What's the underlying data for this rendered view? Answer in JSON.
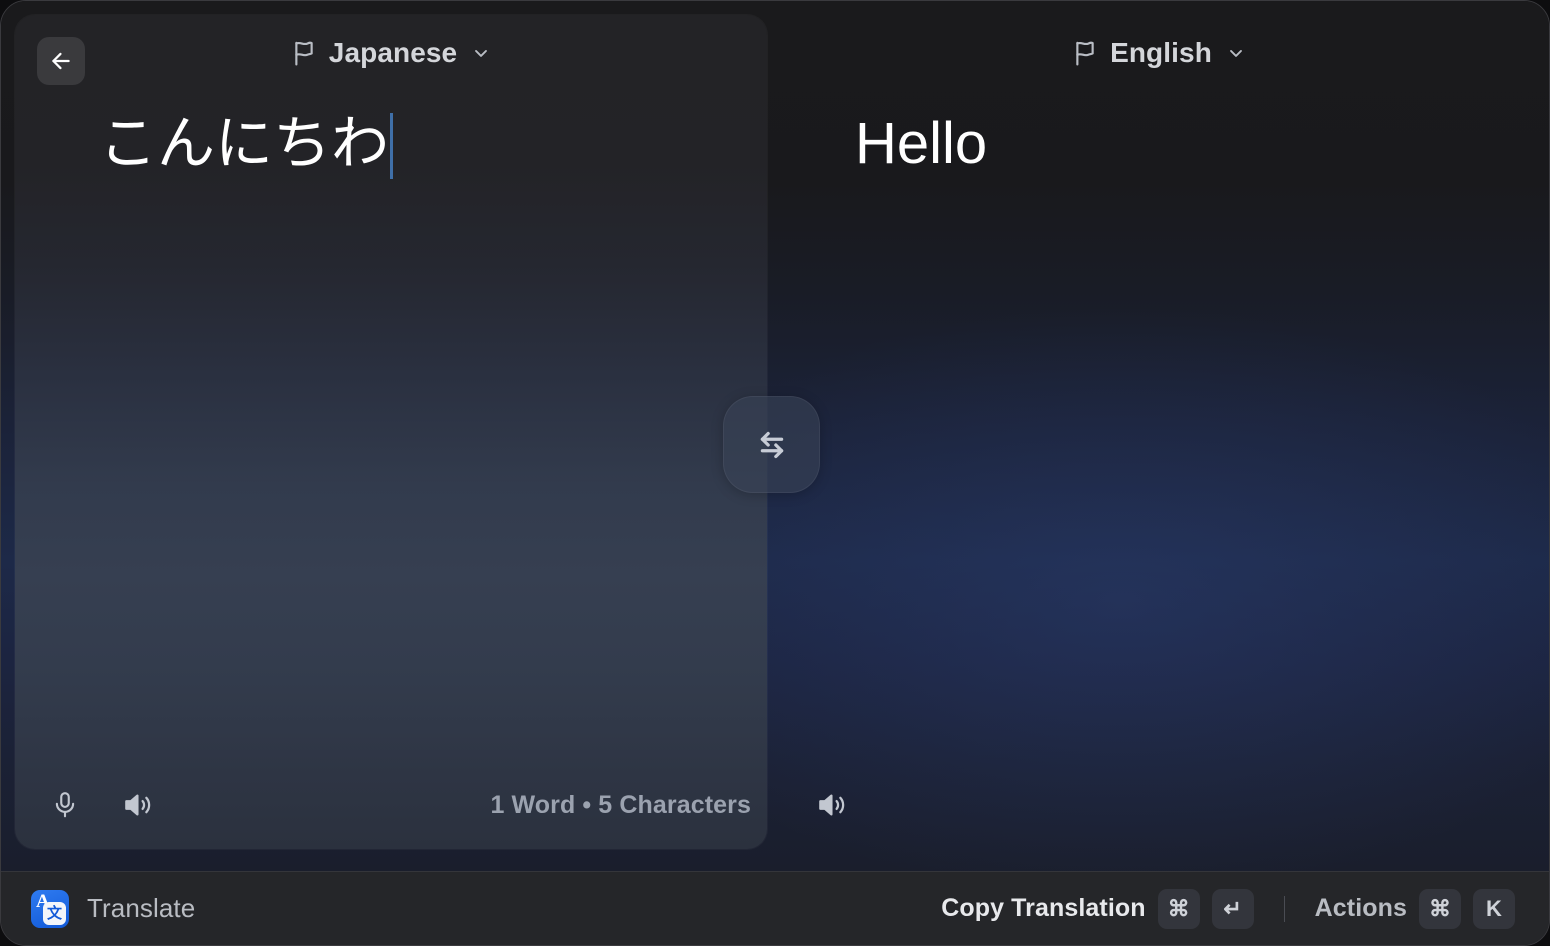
{
  "window": {
    "app_name": "Translate"
  },
  "source_pane": {
    "language": "Japanese",
    "flag_icon": "flag-icon",
    "chevron_icon": "chevron-down-icon",
    "text": "こんにちわ",
    "mic_icon": "microphone-icon",
    "speaker_icon": "speaker-icon",
    "word_count": "1 Word • 5 Characters"
  },
  "target_pane": {
    "language": "English",
    "flag_icon": "flag-icon",
    "chevron_icon": "chevron-down-icon",
    "text": "Hello",
    "speaker_icon": "speaker-icon"
  },
  "back_button": {
    "icon": "arrow-left-icon"
  },
  "swap_button": {
    "icon": "swap-horizontal-icon"
  },
  "status_bar": {
    "app_icon": "translate-app-icon",
    "app_letter": "A",
    "app_cjk": "文",
    "app_name": "Translate",
    "primary_action": {
      "label": "Copy Translation",
      "keys": [
        "⌘",
        "↵"
      ]
    },
    "secondary_action": {
      "label": "Actions",
      "keys": [
        "⌘",
        "K"
      ]
    }
  },
  "colors": {
    "accent_blue": "#1159d8",
    "caret_blue": "#3f6fa8",
    "left_panel_top": "#232326",
    "left_panel_mid": "#363f51",
    "right_panel_mid": "#1d2948",
    "status_bar_bg": "#252629"
  }
}
